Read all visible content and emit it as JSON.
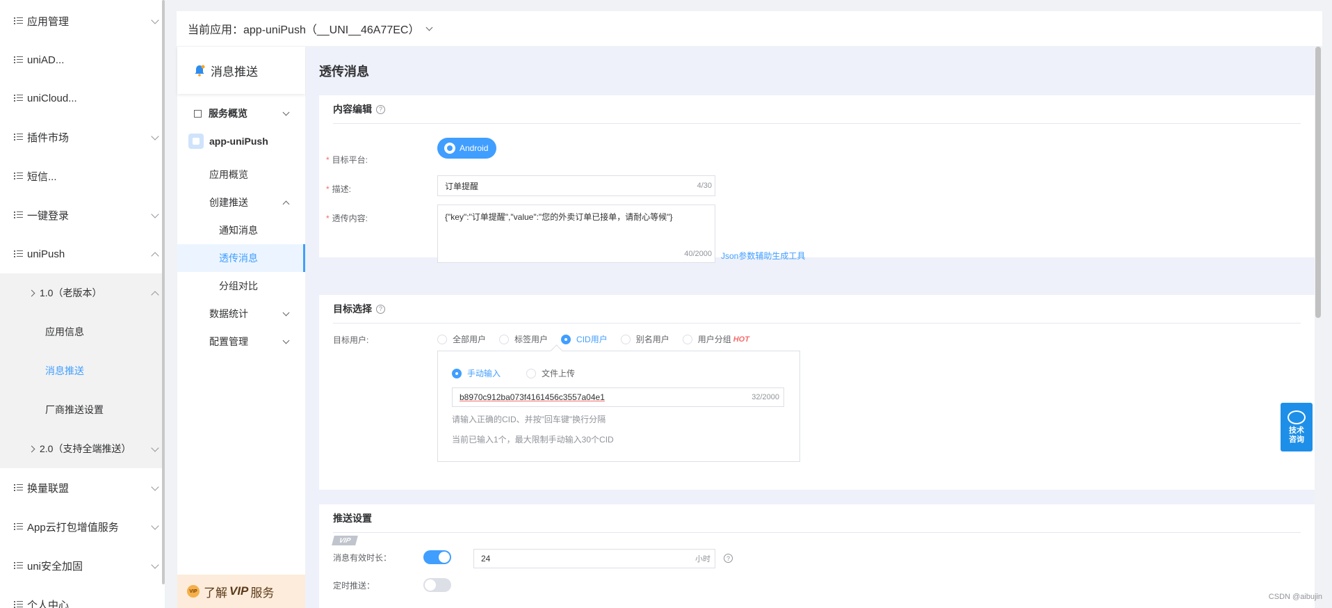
{
  "sidebar": {
    "items": [
      {
        "label": "应用管理",
        "expandable": true
      },
      {
        "label": "uniAD...",
        "expandable": false
      },
      {
        "label": "uniCloud...",
        "expandable": false
      },
      {
        "label": "插件市场",
        "expandable": true
      },
      {
        "label": "短信...",
        "expandable": false
      },
      {
        "label": "一键登录",
        "expandable": true
      },
      {
        "label": "uniPush",
        "expandable": true,
        "expanded": true
      },
      {
        "label": "换量联盟",
        "expandable": true
      },
      {
        "label": "App云打包增值服务",
        "expandable": true
      },
      {
        "label": "uni安全加固",
        "expandable": true
      },
      {
        "label": "个人中心",
        "expandable": true
      }
    ],
    "unipush_sub": [
      {
        "label": "1.0（老版本）"
      },
      {
        "label": "应用信息"
      },
      {
        "label": "消息推送",
        "active": true
      },
      {
        "label": "厂商推送设置"
      },
      {
        "label": "2.0（支持全端推送）"
      }
    ]
  },
  "topbar": {
    "current_app": "当前应用：app-uniPush（__UNI__46A77EC）"
  },
  "push_menu": {
    "title": "消息推送",
    "items": [
      {
        "label": "服务概览"
      },
      {
        "label": "app-uniPush"
      },
      {
        "label": "应用概览"
      },
      {
        "label": "创建推送"
      },
      {
        "label": "通知消息"
      },
      {
        "label": "透传消息",
        "active": true
      },
      {
        "label": "分组对比"
      },
      {
        "label": "数据统计"
      },
      {
        "label": "配置管理"
      }
    ],
    "vip_badge": "VIP",
    "vip_text_1": "了解",
    "vip_text_2": "VIP",
    "vip_text_3": "服务"
  },
  "main": {
    "page_title": "透传消息",
    "content_section": {
      "title": "内容编辑",
      "platform_label": "目标平台:",
      "platform_value": "Android",
      "desc_label": "描述:",
      "desc_value": "订单提醒",
      "desc_count": "4/30",
      "content_label": "透传内容:",
      "content_value": "{\"key\":\"订单提醒\",\"value\":\"您的外卖订单已接单，请耐心等候\"}",
      "content_count": "40/2000",
      "json_tool_link": "Json参数辅助生成工具"
    },
    "target_section": {
      "title": "目标选择",
      "target_label": "目标用户:",
      "options": [
        "全部用户",
        "标签用户",
        "CID用户",
        "别名用户",
        "用户分组"
      ],
      "selected": "CID用户",
      "hot": "HOT",
      "input_modes": [
        "手动输入",
        "文件上传"
      ],
      "input_mode_selected": "手动输入",
      "cid_value": "b8970c912ba073f4161456c3557a04e1",
      "cid_count": "32/2000",
      "hint_1": "请输入正确的CID、并按\"回车键\"换行分隔",
      "hint_2": "当前已输入1个，最大限制手动输入30个CID"
    },
    "push_settings": {
      "title": "推送设置",
      "vip_tag": "VIP",
      "ttl_label": "消息有效时长：",
      "ttl_value": "24",
      "ttl_unit": "小时",
      "ttl_enabled": true,
      "scheduled_label": "定时推送：",
      "scheduled_enabled": false
    }
  },
  "float_button": {
    "line1": "技术",
    "line2": "咨询"
  },
  "watermark": "CSDN @aibujin",
  "colors": {
    "accent": "#409eff",
    "required": "#f56c6c",
    "hot": "#f56c6c",
    "vip_bg": "#fdecdb"
  }
}
